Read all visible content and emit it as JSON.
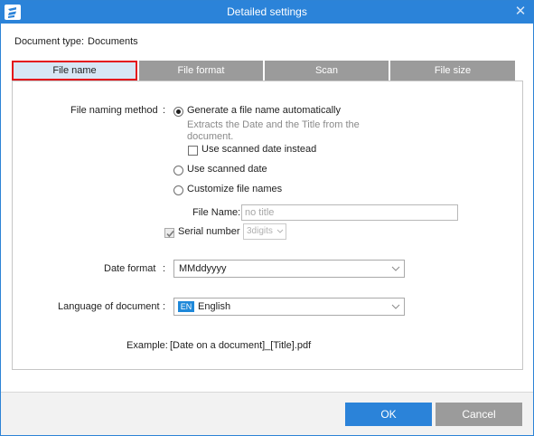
{
  "window": {
    "title": "Detailed settings",
    "close_glyph": "✕",
    "logo_icon": "app-logo-icon"
  },
  "document_type": {
    "label": "Document type:",
    "value": "Documents"
  },
  "tabs": [
    {
      "label": "File name",
      "active": true
    },
    {
      "label": "File format",
      "active": false
    },
    {
      "label": "Scan",
      "active": false
    },
    {
      "label": "File size",
      "active": false
    }
  ],
  "file_naming": {
    "label": "File naming method",
    "colon": ":",
    "options": [
      {
        "label": "Generate a file name automatically",
        "selected": true
      },
      {
        "label": "Use scanned date",
        "selected": false
      },
      {
        "label": "Customize file names",
        "selected": false
      }
    ],
    "description_line1": "Extracts the Date and the Title from the",
    "description_line2": "document.",
    "use_scanned_date_instead": {
      "label": "Use scanned date instead",
      "checked": false
    },
    "file_name_field": {
      "label": "File Name:",
      "placeholder": "no title"
    },
    "serial_number": {
      "label": "Serial number",
      "checked": true,
      "digits_value": "3digits"
    }
  },
  "date_format": {
    "label": "Date format",
    "colon": ":",
    "value": "MMddyyyy"
  },
  "language": {
    "label": "Language of document",
    "colon": ":",
    "badge": "EN",
    "value": "English"
  },
  "example": {
    "label": "Example:",
    "value": "[Date on a document]_[Title].pdf"
  },
  "buttons": {
    "ok": "OK",
    "cancel": "Cancel"
  },
  "colors": {
    "title_bar": "#2b83d9",
    "tab_inactive": "#9b9b9b",
    "tab_active_bg": "#d7e6f5",
    "tab_active_border": "#e4111b",
    "ok_button": "#2b83d9",
    "cancel_button": "#9b9b9b"
  }
}
